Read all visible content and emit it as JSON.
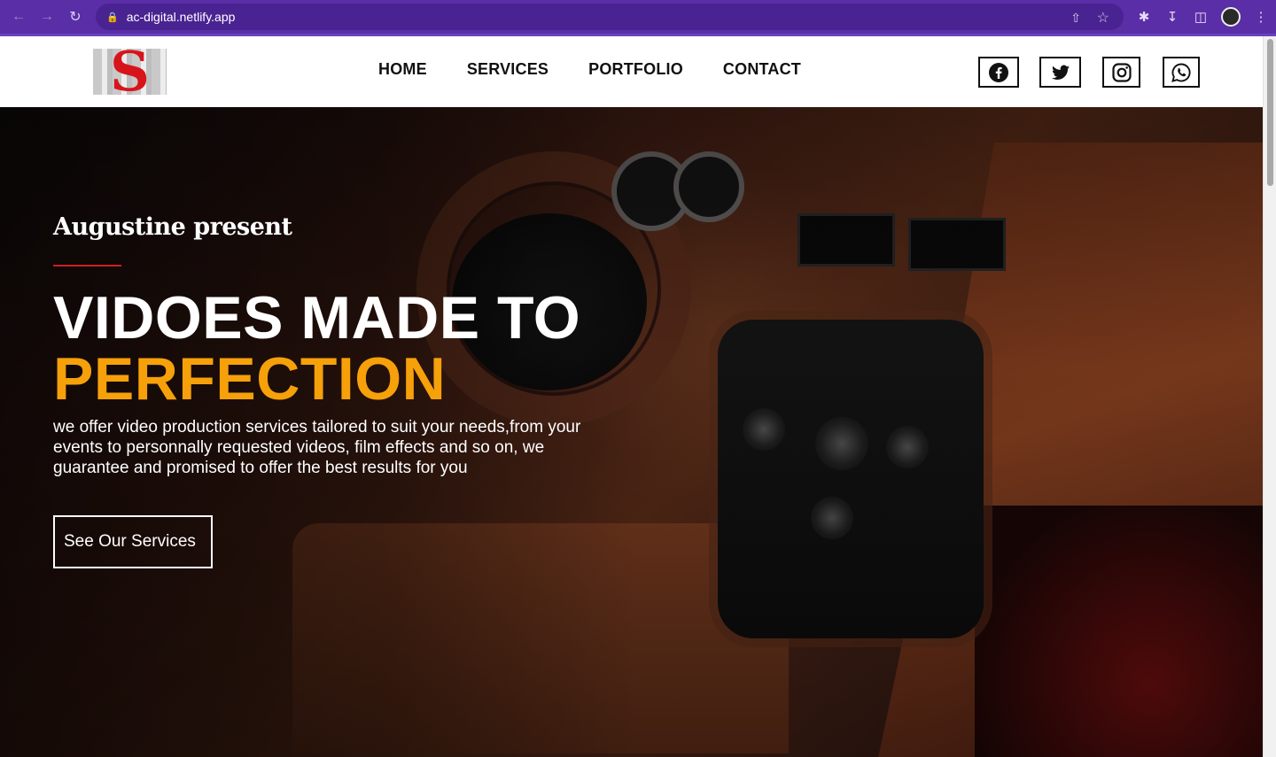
{
  "browser": {
    "url": "ac-digital.netlify.app",
    "back_icon": "back-arrow-icon",
    "forward_icon": "forward-arrow-icon",
    "reload_icon": "reload-icon",
    "lock_icon": "lock-icon"
  },
  "header": {
    "logo_letter": "S",
    "nav": [
      "HOME",
      "SERVICES",
      "PORTFOLIO",
      "CONTACT"
    ],
    "social": [
      "facebook-icon",
      "twitter-icon",
      "instagram-icon",
      "whatsapp-icon"
    ]
  },
  "hero": {
    "presenter": "Augustine present",
    "headline_line1": "VIDOES MADE TO",
    "headline_line2": "PERFECTION",
    "lead": "we offer video production services tailored to suit your needs,from your events to personnally requested videos, film effects and so on, we guarantee and promised to offer the best results for you",
    "cta": "See Our Services"
  },
  "colors": {
    "accent": "#f6a00a",
    "rule": "#d11e1e",
    "browser_chrome": "#5a2ea6"
  }
}
